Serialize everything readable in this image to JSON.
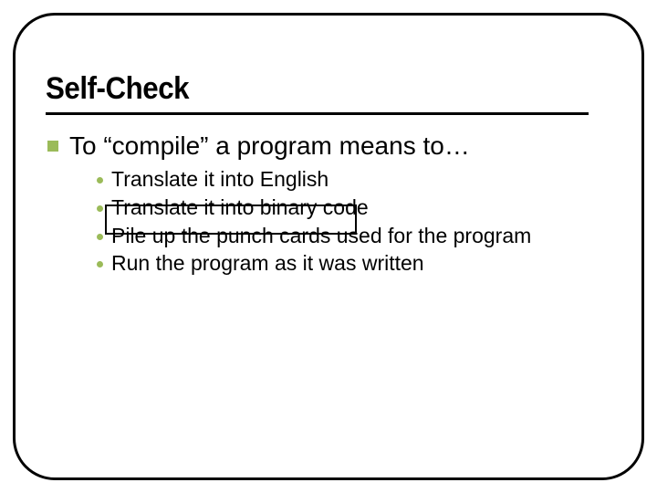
{
  "slide": {
    "title": "Self-Check",
    "question": "To “compile” a program means to…",
    "options": [
      "Translate it into English",
      "Translate it into binary code",
      "Pile up the punch cards used for the program",
      "Run the program as it was written"
    ],
    "highlight_index": 1
  },
  "style": {
    "accent_color": "#9bbb59"
  }
}
